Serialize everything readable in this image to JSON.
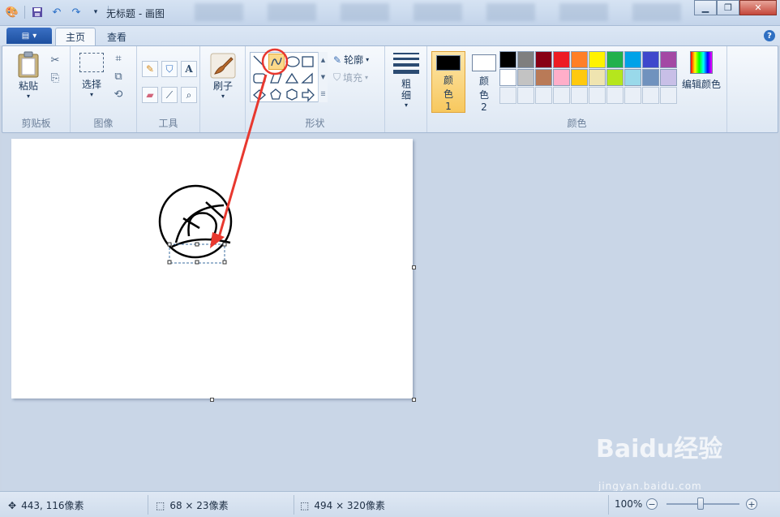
{
  "window": {
    "title": "无标题 - 画图",
    "minimize_icon": "minimize-icon",
    "maximize_icon": "restore-icon",
    "close_icon": "close-icon"
  },
  "tabs": {
    "home": "主页",
    "view": "查看"
  },
  "ribbon": {
    "clipboard": {
      "group_label": "剪贴板",
      "paste_label": "粘贴"
    },
    "image": {
      "group_label": "图像",
      "select_label": "选择"
    },
    "tools": {
      "group_label": "工具"
    },
    "brush": {
      "label": "刷子"
    },
    "shapes": {
      "group_label": "形状",
      "outline_label": "轮廓",
      "fill_label": "填充",
      "selected_shape": "curve"
    },
    "size": {
      "label": "粗细"
    },
    "colors": {
      "group_label": "颜色",
      "color1_label": "颜色 1",
      "color2_label": "颜色 2",
      "color1_value": "#000000",
      "color2_value": "#ffffff",
      "edit_label": "编辑颜色",
      "palette": [
        "#000000",
        "#7f7f7f",
        "#880015",
        "#ed1c24",
        "#ff7f27",
        "#fff200",
        "#22b14c",
        "#00a2e8",
        "#3f48cc",
        "#a349a4",
        "#ffffff",
        "#c3c3c3",
        "#b97a57",
        "#ffaec9",
        "#ffc90e",
        "#efe4b0",
        "#b5e61d",
        "#99d9ea",
        "#7092be",
        "#c8bfe7"
      ]
    }
  },
  "status": {
    "cursor_pos": "443, 116像素",
    "selection_size": "68 × 23像素",
    "image_size": "494 × 320像素",
    "zoom": "100%"
  },
  "watermark": {
    "brand": "Baidu经验",
    "url": "jingyan.baidu.com"
  }
}
